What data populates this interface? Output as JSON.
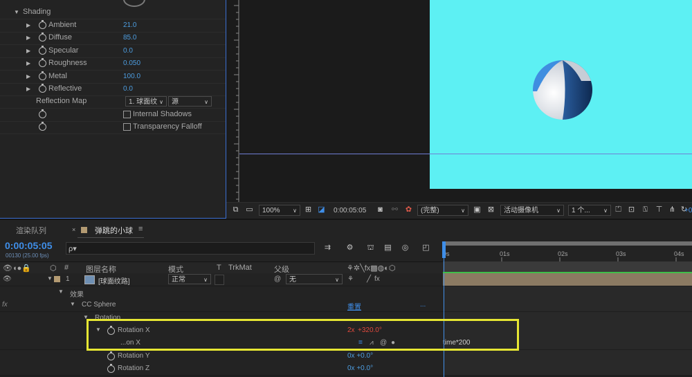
{
  "effect_controls": {
    "section_label": "Shading",
    "properties": [
      {
        "label": "Ambient",
        "value": "21.0"
      },
      {
        "label": "Diffuse",
        "value": "85.0"
      },
      {
        "label": "Specular",
        "value": "0.0"
      },
      {
        "label": "Roughness",
        "value": "0.050"
      },
      {
        "label": "Metal",
        "value": "100.0"
      },
      {
        "label": "Reflective",
        "value": "0.0"
      }
    ],
    "reflection_map": {
      "label": "Reflection Map",
      "layer_value": "1. 球面纹",
      "source_value": "源"
    },
    "internal_shadows_label": "Internal Shadows",
    "transparency_falloff_label": "Transparency Falloff"
  },
  "viewer_toolbar": {
    "zoom": "100%",
    "timecode": "0:00:05:05",
    "resolution": "(完整)",
    "camera": "活动摄像机",
    "views": "1 个...",
    "trailing": "+0"
  },
  "colors": {
    "canvas": "#5df0f3",
    "accent_blue": "#3f8ee8",
    "highlight": "#e6e633",
    "value_blue": "#4d9de0",
    "value_red": "#e0493d"
  },
  "timeline": {
    "tabs": [
      {
        "label": "渲染队列"
      },
      {
        "label": "弹跳的小球"
      }
    ],
    "timecode": "0:00:05:05",
    "fps_label": "00130 (25.00 fps)",
    "search_placeholder": "ρ▾",
    "ruler_labels": [
      "0s",
      "01s",
      "02s",
      "03s",
      "04s"
    ],
    "columns": {
      "num": "#",
      "layer_name": "图层名称",
      "mode": "模式",
      "t": "T",
      "trkmat": "TrkMat",
      "parent": "父级"
    },
    "layer": {
      "number": "1",
      "name": "[球面纹路]",
      "mode": "正常",
      "parent": "无"
    },
    "effects_label": "效果",
    "fx_label": "fx",
    "effect_name": "CC Sphere",
    "reset_label": "重置",
    "ellipsis": "...",
    "rotation_group": "Rotation",
    "rotation_x": {
      "label": "Rotation X",
      "value_rev": "2x",
      "value_deg": "+320.0°"
    },
    "expression_label": "...on X",
    "expression_text": "time*200",
    "rotation_y": {
      "label": "Rotation Y",
      "value": "0x +0.0°"
    },
    "rotation_z": {
      "label": "Rotation Z",
      "value": "0x +0.0°"
    }
  }
}
